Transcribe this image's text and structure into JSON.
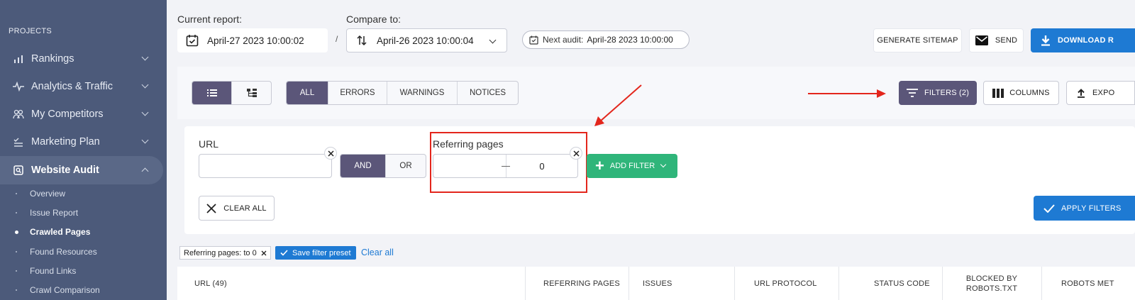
{
  "sidebar": {
    "section_title": "PROJECTS",
    "items": [
      {
        "label": "Rankings",
        "icon": "bar-chart-icon"
      },
      {
        "label": "Analytics & Traffic",
        "icon": "pulse-icon"
      },
      {
        "label": "My Competitors",
        "icon": "users-icon"
      },
      {
        "label": "Marketing Plan",
        "icon": "checklist-icon"
      },
      {
        "label": "Website Audit",
        "icon": "audit-icon"
      }
    ],
    "sub_items": [
      "Overview",
      "Issue Report",
      "Crawled Pages",
      "Found Resources",
      "Found Links",
      "Crawl Comparison"
    ],
    "current_sub": "Crawled Pages"
  },
  "header": {
    "current_report_label": "Current report:",
    "current_report_value": "April-27 2023 10:00:02",
    "compare_label": "Compare to:",
    "compare_value": "April-26 2023 10:00:04",
    "separator": "/",
    "next_audit_label": "Next audit:",
    "next_audit_value": "April-28 2023 10:00:00",
    "generate_sitemap": "GENERATE SITEMAP",
    "send": "SEND",
    "download": "DOWNLOAD R"
  },
  "toolbar": {
    "tabs": [
      "ALL",
      "ERRORS",
      "WARNINGS",
      "NOTICES"
    ],
    "active_tab": "ALL",
    "filters": "FILTERS (2)",
    "columns": "COLUMNS",
    "export": "EXPO"
  },
  "filters": {
    "url_label": "URL",
    "url_value": "",
    "and": "AND",
    "or": "OR",
    "referring_label": "Referring pages",
    "referring_from": "",
    "referring_to": "0",
    "add_filter": "ADD FILTER",
    "clear_all": "CLEAR ALL",
    "apply": "APPLY FILTERS"
  },
  "chips": {
    "active_filter": "Referring pages:  to 0",
    "save_preset": "Save filter preset",
    "clear_all": "Clear all"
  },
  "table": {
    "columns": [
      "URL  (49)",
      "REFERRING PAGES",
      "ISSUES",
      "URL PROTOCOL",
      "STATUS CODE",
      "BLOCKED BY ROBOTS.TXT",
      "ROBOTS MET"
    ]
  },
  "colors": {
    "sidebar": "#4c5a7a",
    "accent_purple": "#5b5679",
    "accent_blue": "#1e7ad3",
    "accent_green": "#2fb57a",
    "annotation_red": "#e3261c"
  }
}
